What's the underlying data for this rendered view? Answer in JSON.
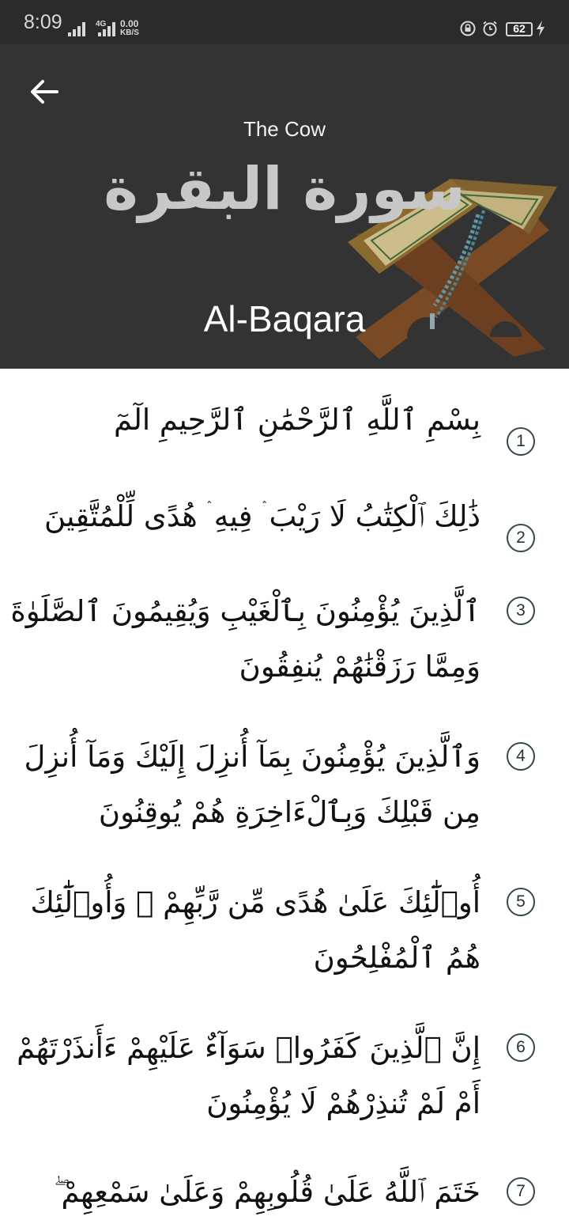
{
  "status_bar": {
    "time": "8:09",
    "network_label": "4G",
    "speed_value": "0.00",
    "speed_unit": "KB/S",
    "battery_level": "62"
  },
  "header": {
    "subtitle": "The Cow",
    "arabic_name": "سورة البقرة",
    "latin_name": "Al-Baqara"
  },
  "verses": [
    {
      "number": "1",
      "text": "بِسْمِ ٱللَّهِ ٱلرَّحْمَٰنِ ٱلرَّحِيمِ الٓمٓ"
    },
    {
      "number": "2",
      "text": "ذَٰلِكَ ٱلْكِتَٰبُ لَا رَيْبَ ۛ فِيهِ ۛ هُدًى لِّلْمُتَّقِينَ"
    },
    {
      "number": "3",
      "text": "ٱلَّذِينَ يُؤْمِنُونَ بِٱلْغَيْبِ وَيُقِيمُونَ ٱلصَّلَوٰةَ وَمِمَّا رَزَقْنَٰهُمْ يُنفِقُونَ"
    },
    {
      "number": "4",
      "text": "وَٱلَّذِينَ يُؤْمِنُونَ بِمَآ أُنزِلَ إِلَيْكَ وَمَآ أُنزِلَ مِن قَبْلِكَ وَبِٱلْءَاخِرَةِ هُمْ يُوقِنُونَ"
    },
    {
      "number": "5",
      "text": "أُو۟لَٰٓئِكَ عَلَىٰ هُدًى مِّن رَّبِّهِمْ ۖ وَأُو۟لَٰٓئِكَ هُمُ ٱلْمُفْلِحُونَ"
    },
    {
      "number": "6",
      "text": "إِنَّ ٱلَّذِينَ كَفَرُوا۟ سَوَآءٌ عَلَيْهِمْ ءَأَنذَرْتَهُمْ أَمْ لَمْ تُنذِرْهُمْ لَا يُؤْمِنُونَ"
    },
    {
      "number": "7",
      "text": "خَتَمَ ٱللَّهُ عَلَىٰ قُلُوبِهِمْ وَعَلَىٰ سَمْعِهِمْ ۖ"
    }
  ],
  "icons": {
    "back": "arrow-left-icon",
    "signal": "signal-bars-icon",
    "lock": "rotation-lock-icon",
    "alarm": "alarm-clock-icon",
    "battery": "battery-icon",
    "charging": "charging-bolt-icon"
  },
  "colors": {
    "header_bg": "#333333",
    "status_bg": "#2b2b2b",
    "verse_number_border": "#37474f"
  }
}
